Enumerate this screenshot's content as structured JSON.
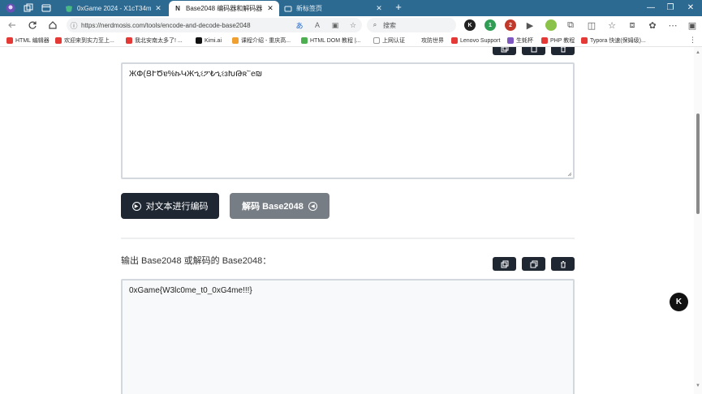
{
  "browser": {
    "tabs": [
      {
        "label": "0xGame 2024 - X1cT34m::CTF",
        "icon": "ctf-favicon",
        "close": "✕"
      },
      {
        "label": "Base2048 编码器和解码器",
        "icon": "N",
        "close": "✕"
      },
      {
        "label": "新标签页",
        "icon": "newtab-favicon",
        "close": "✕"
      }
    ],
    "new_tab": "+",
    "window_controls": {
      "minimize": "—",
      "maximize": "❐",
      "close": "✕"
    },
    "url": "https://nerdmosis.com/tools/encode-and-decode-base2048",
    "search_placeholder": "搜索",
    "extensions": [
      "K",
      "1",
      "2"
    ],
    "bookmarks": [
      "HTML 编辑器",
      "欢迎来到实力至上...",
      "我北安南太多了! ...",
      "Kimi.ai",
      "课程介绍 - 重庆高...",
      "HTML DOM 教程 |...",
      "上网认证",
      "攻防世界",
      "Lenovo Support",
      "生蚝杯",
      "PHP 教程",
      "Typora 快速(保姆级)..."
    ],
    "bookmarks_more": "⋮"
  },
  "page": {
    "input_text": "ЖՓ(ՑՒԾɐ%ኩԿЖኂଽፖ₺ኂଽɜԽԹʀ՟e₪",
    "encode_button": "对文本进行编码",
    "decode_button": "解码 Base2048",
    "output_label": "输出 Base2048 或解码的 Base2048：",
    "output_text": "0xGame{W3lc0me_t0_0xG4me!!!}",
    "fab_label": "K"
  }
}
